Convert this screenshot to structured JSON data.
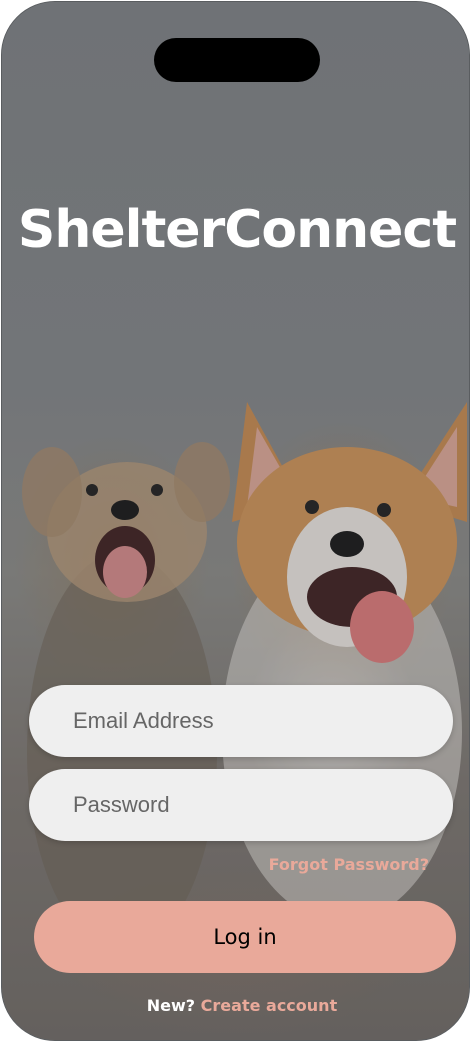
{
  "app": {
    "title": "ShelterConnect"
  },
  "form": {
    "email_placeholder": "Email Address",
    "password_placeholder": "Password",
    "forgot_label": "Forgot Password?",
    "login_label": "Log in"
  },
  "signup": {
    "prompt": "New?",
    "link_label": "Create account"
  },
  "colors": {
    "accent": "#e9a99a",
    "field_bg": "#efefef",
    "title": "#ffffff"
  }
}
